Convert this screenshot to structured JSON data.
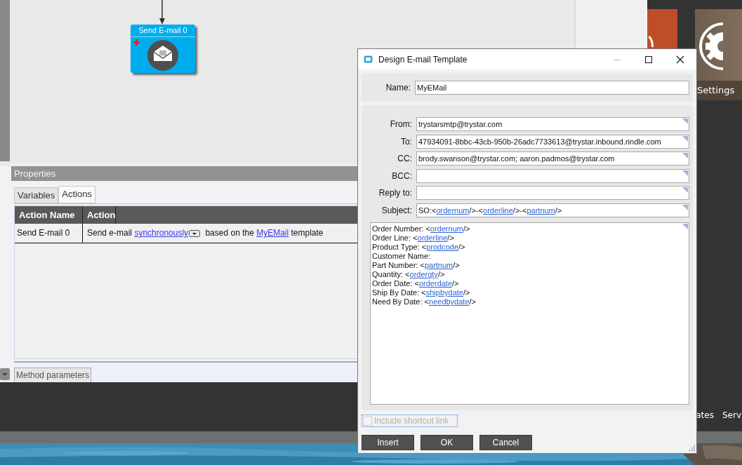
{
  "canvas": {
    "nodes": [
      {
        "title": "Send E-mail 0"
      }
    ]
  },
  "properties": {
    "title": "Properties",
    "tabs": [
      {
        "label": "Variables",
        "selected": false
      },
      {
        "label": "Actions",
        "selected": true
      }
    ],
    "table": {
      "columns": [
        "Action Name",
        "Action"
      ],
      "rows": [
        {
          "name": "Send E-mail 0",
          "action": [
            {
              "kind": "text",
              "text": "Send e-mail "
            },
            {
              "kind": "link",
              "text": "synchronously"
            },
            {
              "kind": "dropdown"
            },
            {
              "kind": "text",
              "text": " based on the "
            },
            {
              "kind": "link",
              "text": "MyEMail"
            },
            {
              "kind": "text",
              "text": " template"
            }
          ]
        }
      ]
    },
    "bottom_tabs": [
      {
        "label": "Method parameters",
        "selected": true
      }
    ]
  },
  "tiles": [
    {
      "label": "Settings"
    }
  ],
  "taskbar_labels": [
    "ates",
    "Serv"
  ],
  "dialog": {
    "title": "Design E-mail Template",
    "name": {
      "label": "Name:",
      "value": "MyEMail"
    },
    "fields": [
      {
        "label": "From:",
        "segments": [
          {
            "kind": "text",
            "text": "trystarsmtp@trystar.com"
          }
        ]
      },
      {
        "label": "To:",
        "segments": [
          {
            "kind": "text",
            "text": "47934091-8bbc-43cb-950b-26adc7733613@trystar.inbound.rindle.com"
          }
        ]
      },
      {
        "label": "CC:",
        "segments": [
          {
            "kind": "text",
            "text": "brody.swanson@trystar.com; aaron.padmos@trystar.com"
          }
        ]
      },
      {
        "label": "BCC:"
      },
      {
        "label": "Reply to:"
      },
      {
        "label": "Subject:",
        "segments": [
          {
            "kind": "text",
            "text": "SO:<"
          },
          {
            "kind": "link",
            "text": "ordernum"
          },
          {
            "kind": "text",
            "text": "/>-<"
          },
          {
            "kind": "link",
            "text": "orderline"
          },
          {
            "kind": "text",
            "text": "/>-<"
          },
          {
            "kind": "link",
            "text": "partnum"
          },
          {
            "kind": "text",
            "text": "/>"
          }
        ]
      }
    ],
    "body": [
      [
        {
          "kind": "text",
          "text": "Order Number: <"
        },
        {
          "kind": "link",
          "text": "ordernum"
        },
        {
          "kind": "text",
          "text": "/>"
        }
      ],
      [
        {
          "kind": "text",
          "text": "Order Line: <"
        },
        {
          "kind": "link",
          "text": "orderline"
        },
        {
          "kind": "text",
          "text": "/>"
        }
      ],
      [
        {
          "kind": "text",
          "text": "Product Type: <"
        },
        {
          "kind": "link",
          "text": "prodcode"
        },
        {
          "kind": "text",
          "text": "/>"
        }
      ],
      [
        {
          "kind": "text",
          "text": "Customer Name:"
        }
      ],
      [
        {
          "kind": "text",
          "text": "Part Number: <"
        },
        {
          "kind": "link",
          "text": "partnum"
        },
        {
          "kind": "text",
          "text": "/>"
        }
      ],
      [
        {
          "kind": "text",
          "text": "Quantity: <"
        },
        {
          "kind": "link",
          "text": "orderqty"
        },
        {
          "kind": "text",
          "text": "/>"
        }
      ],
      [
        {
          "kind": "text",
          "text": "Order Date: <"
        },
        {
          "kind": "link",
          "text": "orderdate"
        },
        {
          "kind": "text",
          "text": "/>"
        }
      ],
      [
        {
          "kind": "text",
          "text": "Ship By Date: <"
        },
        {
          "kind": "link",
          "text": "shipbydate"
        },
        {
          "kind": "text",
          "text": "/>"
        }
      ],
      [
        {
          "kind": "text",
          "text": "Need By Date: <"
        },
        {
          "kind": "link",
          "text": "needbydate"
        },
        {
          "kind": "text",
          "text": "/>"
        }
      ]
    ],
    "shortcut": {
      "label": "Include shortcut link",
      "checked": false,
      "disabled": true
    },
    "buttons": [
      "Insert",
      "OK",
      "Cancel"
    ]
  }
}
